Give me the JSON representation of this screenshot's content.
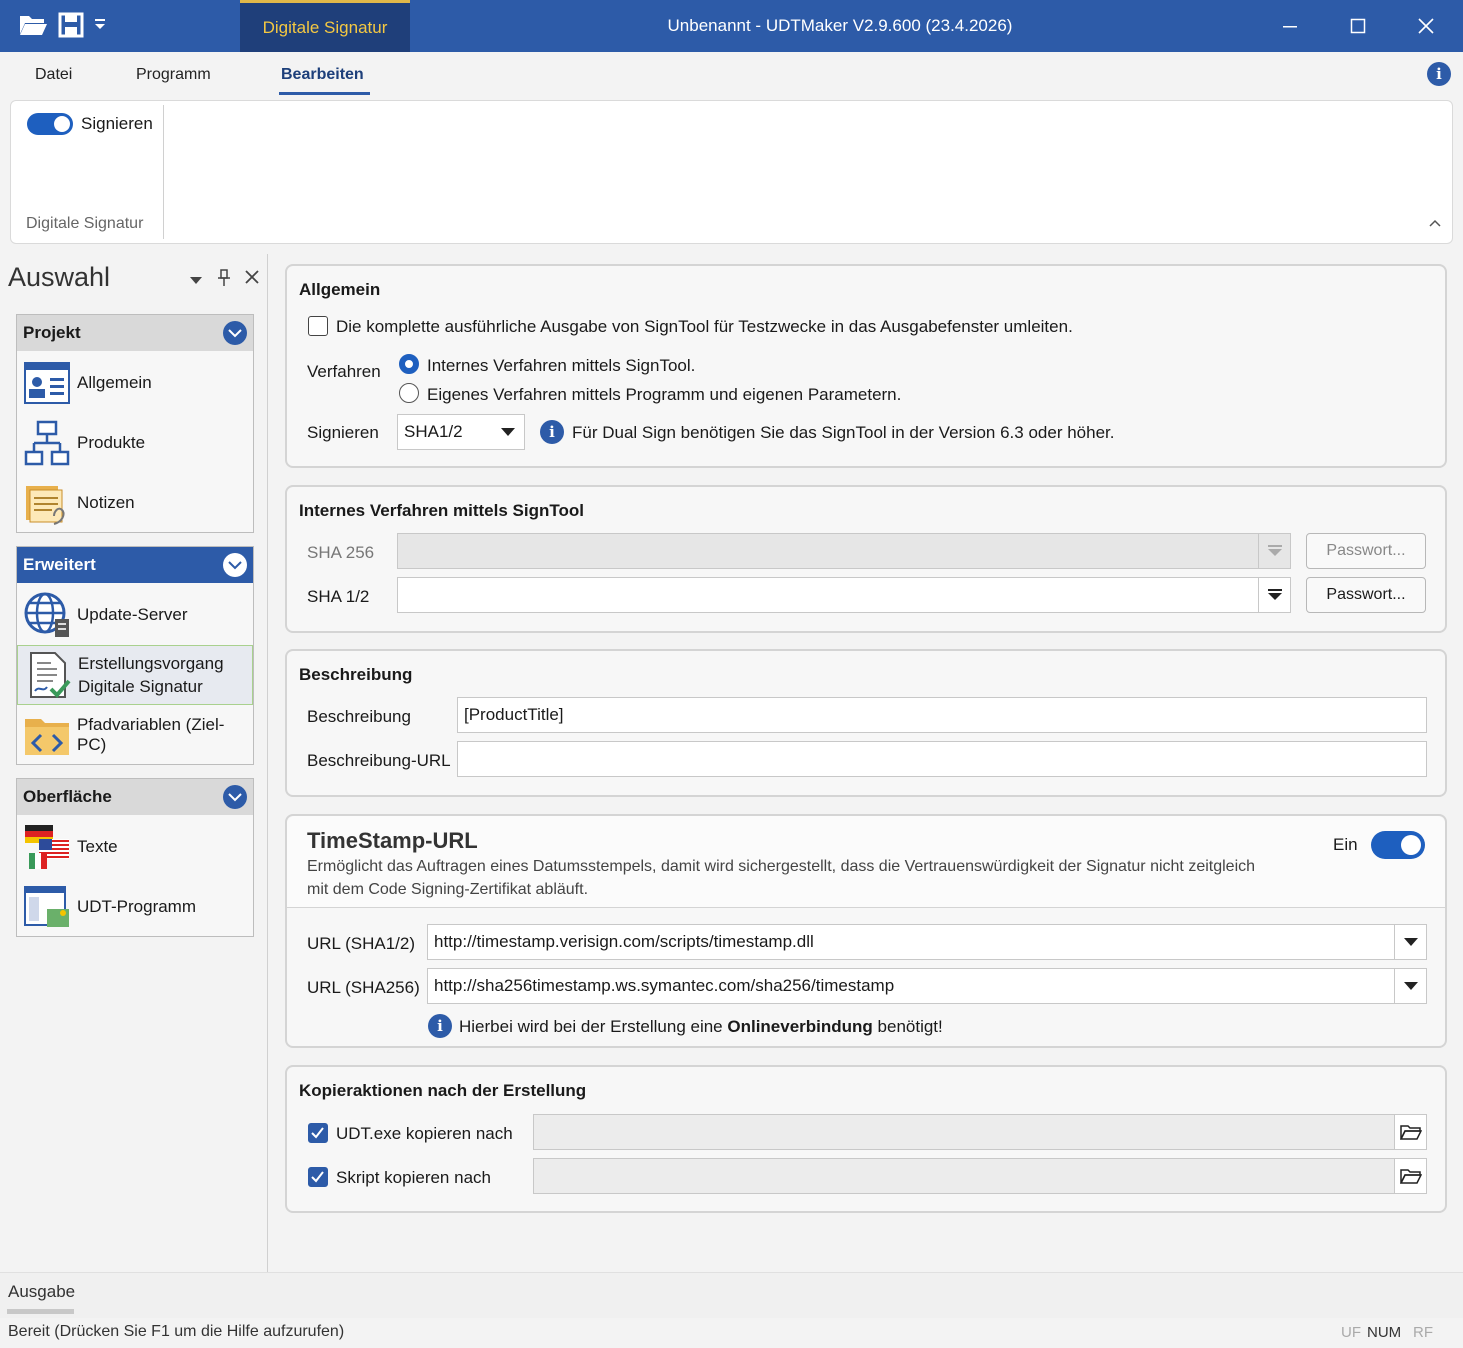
{
  "titlebar": {
    "context_tab": "Digitale Signatur",
    "title": "Unbenannt - UDTMaker V2.9.600 (23.4.2026)"
  },
  "ribbon": {
    "tabs": [
      "Datei",
      "Programm",
      "Bearbeiten"
    ],
    "active_tab": "Bearbeiten",
    "sign_toggle_label": "Signieren",
    "group_label": "Digitale Signatur"
  },
  "sidebar": {
    "title": "Auswahl",
    "groups": [
      {
        "label": "Projekt",
        "items": [
          "Allgemein",
          "Produkte",
          "Notizen"
        ]
      },
      {
        "label": "Erweitert",
        "items": [
          "Update-Server",
          "Erstellungsvorgang\nDigitale Signatur",
          "Pfadvariablen (Ziel-PC)"
        ]
      },
      {
        "label": "Oberfläche",
        "items": [
          "Texte",
          "UDT-Programm"
        ]
      }
    ],
    "erweitert_item2_line1": "Erstellungsvorgang",
    "erweitert_item2_line2": "Digitale Signatur"
  },
  "allgemein": {
    "title": "Allgemein",
    "checkbox_label": "Die komplette ausführliche Ausgabe von SignTool für Testzwecke in das Ausgabefenster umleiten.",
    "verfahren_label": "Verfahren",
    "radio1": "Internes Verfahren mittels SignTool.",
    "radio2": "Eigenes Verfahren mittels Programm und eigenen Parametern.",
    "signieren_label": "Signieren",
    "signieren_value": "SHA1/2",
    "info_text": "Für Dual Sign benötigen Sie das SignTool in der Version 6.3 oder höher."
  },
  "intern": {
    "title": "Internes Verfahren mittels SignTool",
    "sha256_label": "SHA 256",
    "sha12_label": "SHA 1/2",
    "password_button": "Passwort..."
  },
  "beschreibung": {
    "title": "Beschreibung",
    "desc_label": "Beschreibung",
    "desc_value": "[ProductTitle]",
    "url_label": "Beschreibung-URL",
    "url_value": ""
  },
  "timestamp": {
    "title": "TimeStamp-URL",
    "description": "Ermöglicht das Auftragen eines Datumsstempels, damit wird sichergestellt, dass die Vertrauenswürdigkeit der Signatur nicht zeitgleich mit dem Code Signing-Zertifikat abläuft.",
    "toggle_label": "Ein",
    "url1_label": "URL (SHA1/2)",
    "url1_value": "http://timestamp.verisign.com/scripts/timestamp.dll",
    "url2_label": "URL (SHA256)",
    "url2_value": "http://sha256timestamp.ws.symantec.com/sha256/timestamp",
    "note_prefix": "Hierbei wird bei der Erstellung eine ",
    "note_bold": "Onlineverbindung",
    "note_suffix": " benötigt!"
  },
  "kopier": {
    "title": "Kopieraktionen nach der Erstellung",
    "item1": "UDT.exe kopieren nach",
    "item2": "Skript kopieren nach"
  },
  "bottom": {
    "ausgabe_tab": "Ausgabe",
    "status_text": "Bereit (Drücken Sie F1 um die Hilfe aufzurufen)",
    "indicators": [
      "UF",
      "NUM",
      "RF"
    ]
  },
  "colors": {
    "accent": "#2d5ba8",
    "context_tab_text": "#f4c842",
    "toggle_on": "#1e5fbf"
  }
}
